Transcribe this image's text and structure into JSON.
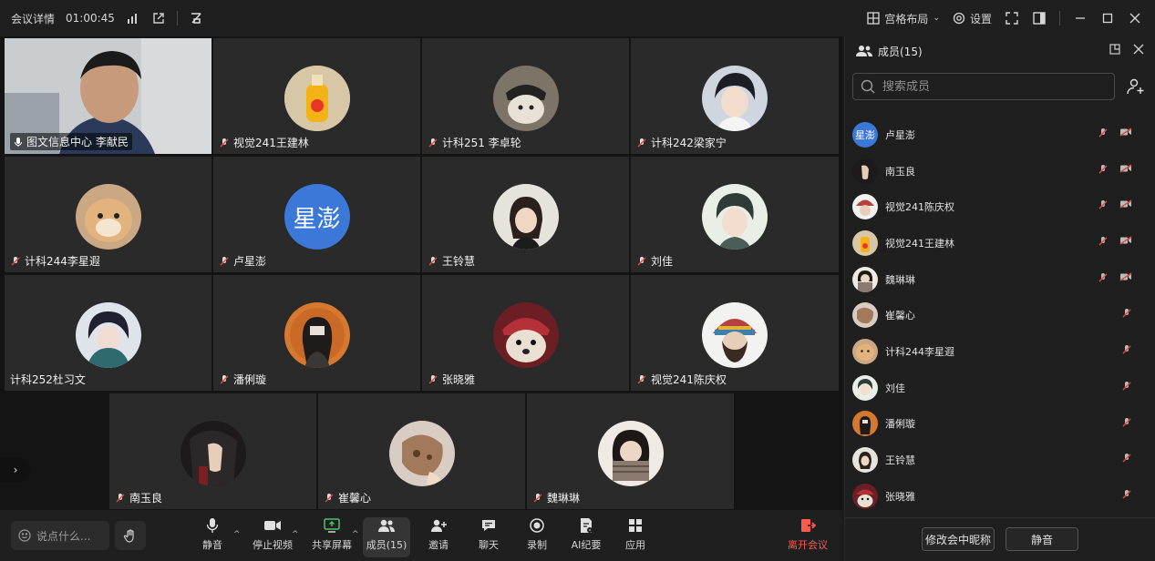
{
  "titlebar": {
    "meeting_details": "会议详情",
    "timer": "01:00:45",
    "layout_label": "宫格布局",
    "settings_label": "设置"
  },
  "tiles": [
    {
      "name": "图文信息中心 李献民",
      "muted": false,
      "video": true
    },
    {
      "name": "视觉241王建林",
      "muted": true,
      "avatar": "bottle"
    },
    {
      "name": "计科251 李卓轮",
      "muted": true,
      "avatar": "dog-hat"
    },
    {
      "name": "计科242梁家宁",
      "muted": true,
      "avatar": "anime-boy"
    },
    {
      "name": "计科244李星遐",
      "muted": true,
      "avatar": "cat"
    },
    {
      "name": "卢星澎",
      "muted": true,
      "avatar_text": "星澎",
      "avatar_color": "#3b78d8"
    },
    {
      "name": "王铃慧",
      "muted": true,
      "avatar": "girl"
    },
    {
      "name": "刘佳",
      "muted": true,
      "avatar": "anime-boy-2"
    },
    {
      "name": "计科252杜习文",
      "muted": false,
      "avatar": "anime-boy-3"
    },
    {
      "name": "潘俐璇",
      "muted": true,
      "avatar": "girl-orange"
    },
    {
      "name": "张晓雅",
      "muted": true,
      "avatar": "dog-red"
    },
    {
      "name": "视觉241陈庆权",
      "muted": true,
      "avatar": "beanie"
    },
    {
      "name": "南玉良",
      "muted": true,
      "avatar": "hand"
    },
    {
      "name": "崔馨心",
      "muted": true,
      "avatar": "bread"
    },
    {
      "name": "魏琳琳",
      "muted": true,
      "avatar": "scarf"
    }
  ],
  "bottom": {
    "chat_placeholder": "说点什么...",
    "tools": [
      {
        "id": "mute",
        "label": "静音"
      },
      {
        "id": "video",
        "label": "停止视频"
      },
      {
        "id": "share",
        "label": "共享屏幕"
      },
      {
        "id": "members",
        "label": "成员(15)"
      },
      {
        "id": "invite",
        "label": "邀请"
      },
      {
        "id": "chat",
        "label": "聊天"
      },
      {
        "id": "record",
        "label": "录制"
      },
      {
        "id": "ai",
        "label": "AI纪要"
      },
      {
        "id": "apps",
        "label": "应用"
      },
      {
        "id": "leave",
        "label": "离开会议"
      }
    ]
  },
  "panel": {
    "title": "成员(15)",
    "search_placeholder": "搜索成员",
    "members": [
      {
        "name": "卢星澎",
        "avatar_text": "星澎",
        "avatar_color": "#3b78d8",
        "cam_off": true
      },
      {
        "name": "南玉良",
        "cam_off": true,
        "avatar": "hand"
      },
      {
        "name": "视觉241陈庆权",
        "cam_off": true,
        "avatar": "beanie"
      },
      {
        "name": "视觉241王建林",
        "cam_off": true,
        "avatar": "bottle"
      },
      {
        "name": "魏琳琳",
        "cam_off": true,
        "avatar": "scarf"
      },
      {
        "name": "崔馨心",
        "cam_off": false,
        "avatar": "bread"
      },
      {
        "name": "计科244李星遐",
        "cam_off": false,
        "avatar": "cat"
      },
      {
        "name": "刘佳",
        "cam_off": false,
        "avatar": "anime-boy-2"
      },
      {
        "name": "潘俐璇",
        "cam_off": false,
        "avatar": "girl-orange"
      },
      {
        "name": "王铃慧",
        "cam_off": false,
        "avatar": "girl"
      },
      {
        "name": "张晓雅",
        "cam_off": false,
        "avatar": "dog-red"
      }
    ],
    "rename_label": "修改会中昵称",
    "mute_label": "静音"
  }
}
